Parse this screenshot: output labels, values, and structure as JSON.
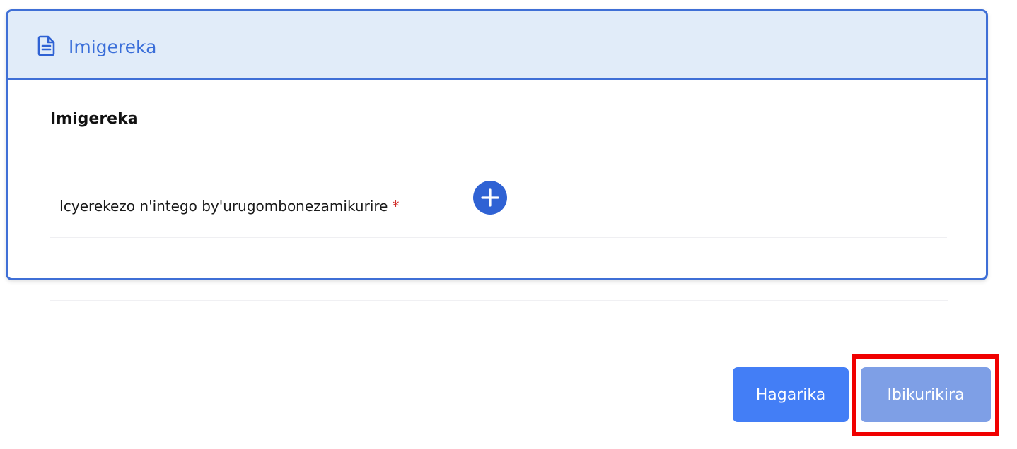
{
  "card": {
    "header_title": "Imigereka",
    "header_icon": "document-icon",
    "section_title": "Imigereka",
    "field_label": "Icyerekezo n'intego by'urugombonezamikurire",
    "required_marker": "*",
    "add_icon": "plus-icon"
  },
  "actions": {
    "cancel_label": "Hagarika",
    "next_label": "Ibikurikira"
  },
  "colors": {
    "accent": "#3f6fd6",
    "header_bg": "#e1ecf9",
    "cancel_button": "#437ef6",
    "next_button_disabled": "#7e9fe6",
    "required": "#d0302b",
    "highlight": "#f00000"
  }
}
